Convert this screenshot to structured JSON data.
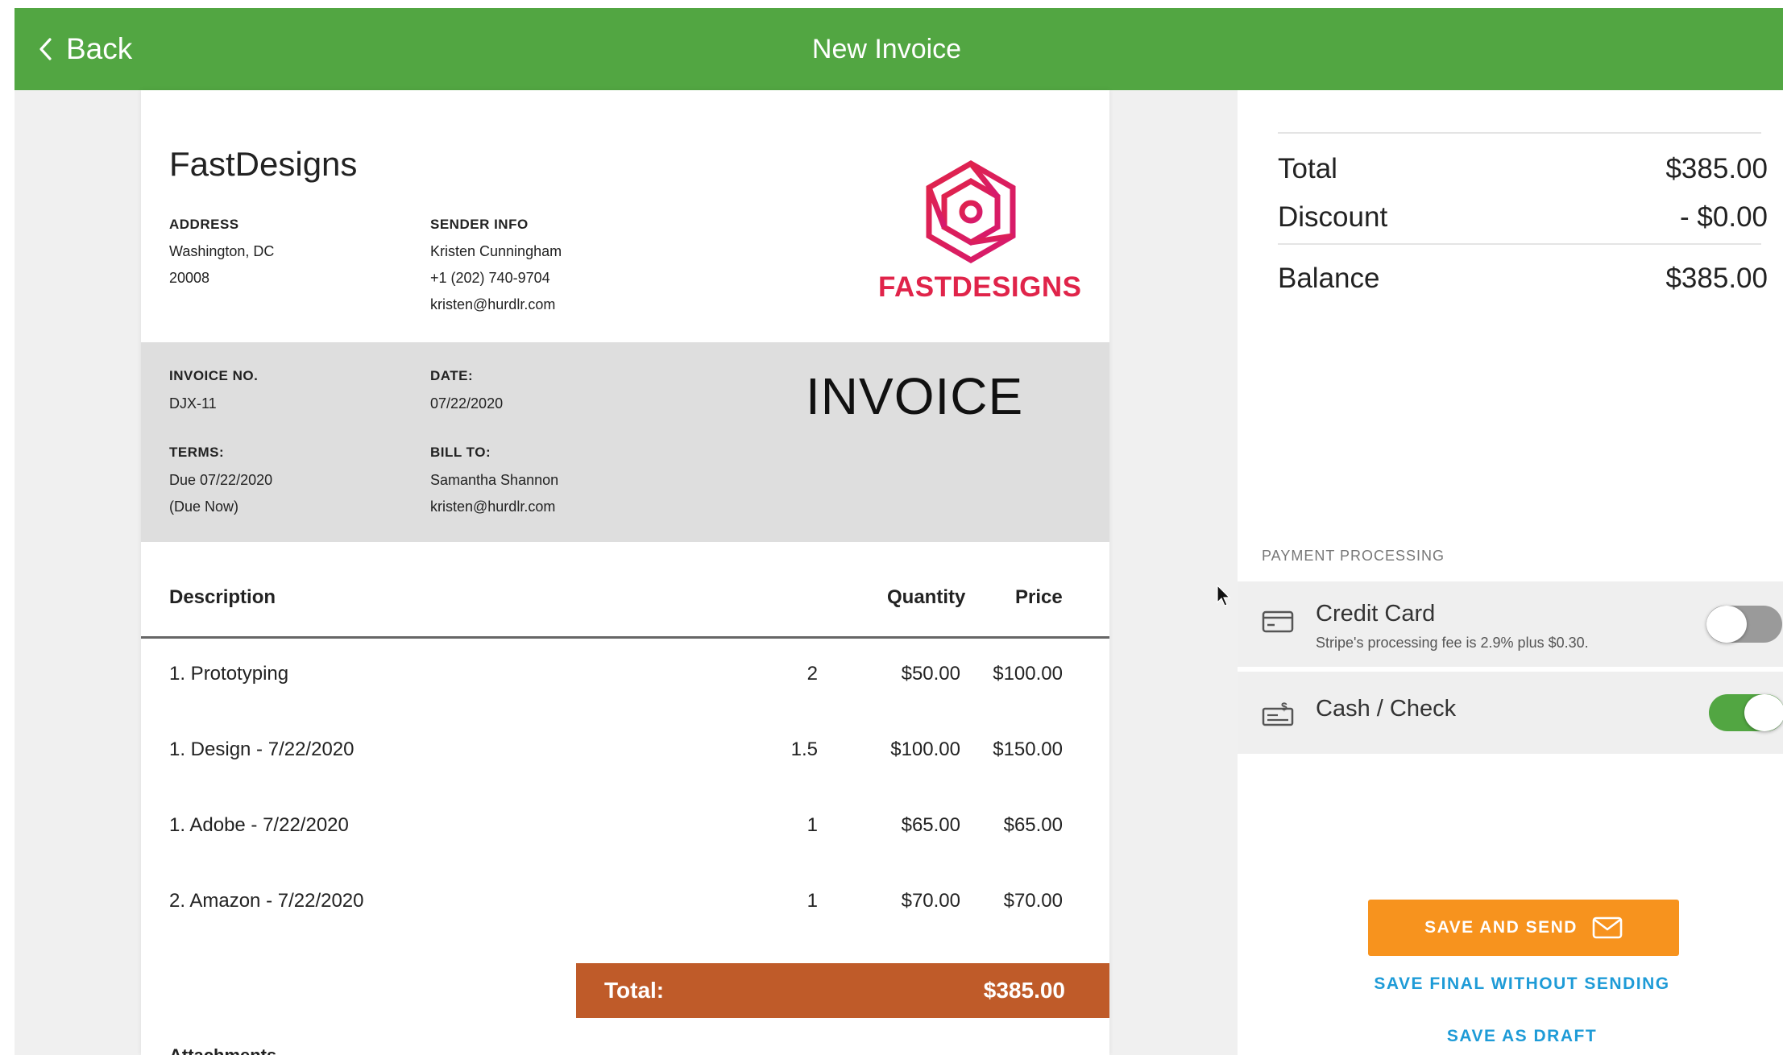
{
  "header": {
    "back_label": "Back",
    "title": "New Invoice"
  },
  "invoice": {
    "company_name": "FastDesigns",
    "logo_text": "FASTDESIGNS",
    "address": {
      "label": "ADDRESS",
      "line1": "Washington, DC",
      "line2": "20008"
    },
    "sender": {
      "label": "SENDER INFO",
      "name": "Kristen Cunningham",
      "phone": "+1 (202) 740-9704",
      "email": "kristen@hurdlr.com"
    },
    "heading": "INVOICE",
    "invoice_no": {
      "label": "INVOICE NO.",
      "value": "DJX-11"
    },
    "date": {
      "label": "DATE:",
      "value": "07/22/2020"
    },
    "terms": {
      "label": "TERMS:",
      "line1": "Due 07/22/2020",
      "line2": "(Due Now)"
    },
    "bill_to": {
      "label": "BILL TO:",
      "name": "Samantha Shannon",
      "email": "kristen@hurdlr.com"
    },
    "columns": {
      "description": "Description",
      "quantity": "Quantity",
      "price": "Price"
    },
    "items": [
      {
        "description": "1. Prototyping",
        "quantity": "2",
        "price": "$50.00",
        "amount": "$100.00"
      },
      {
        "description": "1. Design - 7/22/2020",
        "quantity": "1.5",
        "price": "$100.00",
        "amount": "$150.00"
      },
      {
        "description": "1. Adobe - 7/22/2020",
        "quantity": "1",
        "price": "$65.00",
        "amount": "$65.00"
      },
      {
        "description": "2. Amazon - 7/22/2020",
        "quantity": "1",
        "price": "$70.00",
        "amount": "$70.00"
      }
    ],
    "total_label": "Total:",
    "total_value": "$385.00",
    "attachments_label": "Attachments"
  },
  "summary": {
    "total_label": "Total",
    "total_value": "$385.00",
    "discount_label": "Discount",
    "discount_value": "- $0.00",
    "balance_label": "Balance",
    "balance_value": "$385.00"
  },
  "payment_processing": {
    "label": "PAYMENT PROCESSING",
    "credit_card": {
      "title": "Credit Card",
      "subtitle": "Stripe's processing fee is 2.9% plus $0.30.",
      "enabled": false
    },
    "cash_check": {
      "title": "Cash / Check",
      "enabled": true
    }
  },
  "actions": {
    "save_and_send": "SAVE AND SEND",
    "save_final": "SAVE FINAL WITHOUT SENDING",
    "save_draft": "SAVE AS DRAFT"
  },
  "colors": {
    "header_green": "#52a642",
    "total_bar": "#bf5b29",
    "send_button": "#f7931e",
    "link_blue": "#1e9bd7",
    "logo_pink": "#e0244a",
    "toggle_on": "#52a642",
    "toggle_off": "#9a9a9a"
  }
}
